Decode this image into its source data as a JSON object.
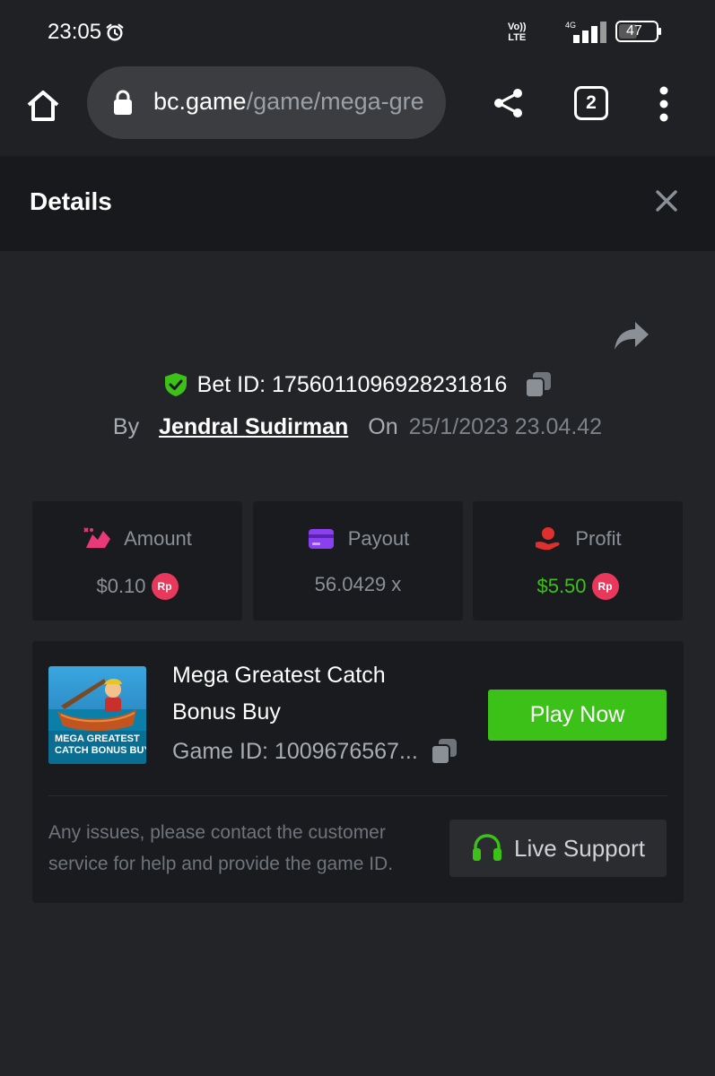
{
  "status_bar": {
    "time": "23:05",
    "network_tag": "Vo)) LTE",
    "network_line1": "Vo))",
    "network_line2": "LTE",
    "signal_label": "4G",
    "battery": "47"
  },
  "browser": {
    "url_host": "bc.game",
    "url_path": "/game/mega-gre",
    "tab_count": "2"
  },
  "details": {
    "title": "Details",
    "bet_id": "Bet ID: 1756011096928231816",
    "by_label": "By",
    "username": "Jendral Sudirman",
    "on_label": "On",
    "date": "25/1/2023 23.04.42"
  },
  "stats": {
    "amount": {
      "label": "Amount",
      "value": "$0.10",
      "currency_badge": "Rp"
    },
    "payout": {
      "label": "Payout",
      "value": "56.0429 x"
    },
    "profit": {
      "label": "Profit",
      "value": "$5.50",
      "currency_badge": "Rp"
    }
  },
  "game": {
    "title": "Mega Greatest Catch Bonus Buy",
    "thumb_text_line1": "MEGA GREATEST",
    "thumb_text_line2": "CATCH BONUS BUY",
    "game_id": "Game ID: 1009676567...",
    "play_label": "Play Now",
    "help_text": "Any issues, please contact the customer service for help and provide the game ID.",
    "support_label": "Live Support"
  },
  "colors": {
    "background": "#232428",
    "card": "#1a1b1e",
    "accent_green": "#3bc117",
    "badge_red": "#e8385b",
    "amount_icon": "#e83a76",
    "payout_icon": "#8a3ff0",
    "profit_icon": "#e0302e"
  },
  "icons": [
    "alarm-icon",
    "home-icon",
    "lock-icon",
    "share-icon",
    "tabs-icon",
    "overflow-menu-icon",
    "close-icon",
    "forward-share-icon",
    "shield-check-icon",
    "copy-icon",
    "amount-icon",
    "payout-card-icon",
    "profit-icon",
    "headset-icon"
  ]
}
